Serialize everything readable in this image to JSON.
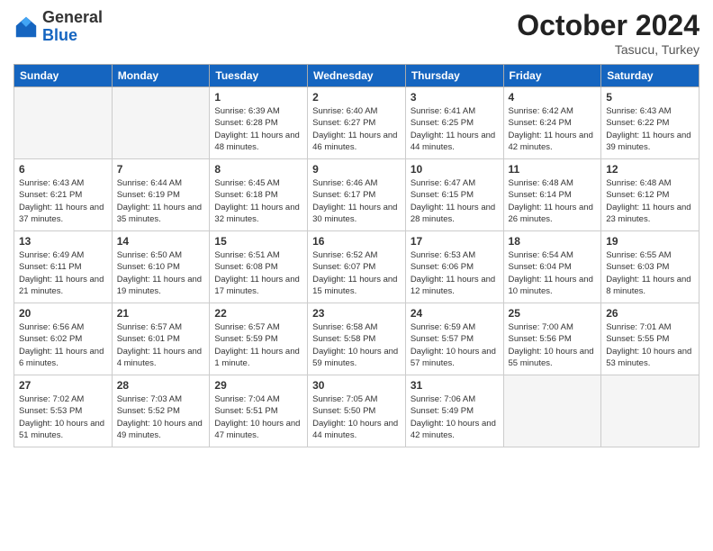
{
  "header": {
    "logo_general": "General",
    "logo_blue": "Blue",
    "month_year": "October 2024",
    "location": "Tasucu, Turkey"
  },
  "weekdays": [
    "Sunday",
    "Monday",
    "Tuesday",
    "Wednesday",
    "Thursday",
    "Friday",
    "Saturday"
  ],
  "weeks": [
    [
      {
        "day": "",
        "info": ""
      },
      {
        "day": "",
        "info": ""
      },
      {
        "day": "1",
        "info": "Sunrise: 6:39 AM\nSunset: 6:28 PM\nDaylight: 11 hours and 48 minutes."
      },
      {
        "day": "2",
        "info": "Sunrise: 6:40 AM\nSunset: 6:27 PM\nDaylight: 11 hours and 46 minutes."
      },
      {
        "day": "3",
        "info": "Sunrise: 6:41 AM\nSunset: 6:25 PM\nDaylight: 11 hours and 44 minutes."
      },
      {
        "day": "4",
        "info": "Sunrise: 6:42 AM\nSunset: 6:24 PM\nDaylight: 11 hours and 42 minutes."
      },
      {
        "day": "5",
        "info": "Sunrise: 6:43 AM\nSunset: 6:22 PM\nDaylight: 11 hours and 39 minutes."
      }
    ],
    [
      {
        "day": "6",
        "info": "Sunrise: 6:43 AM\nSunset: 6:21 PM\nDaylight: 11 hours and 37 minutes."
      },
      {
        "day": "7",
        "info": "Sunrise: 6:44 AM\nSunset: 6:19 PM\nDaylight: 11 hours and 35 minutes."
      },
      {
        "day": "8",
        "info": "Sunrise: 6:45 AM\nSunset: 6:18 PM\nDaylight: 11 hours and 32 minutes."
      },
      {
        "day": "9",
        "info": "Sunrise: 6:46 AM\nSunset: 6:17 PM\nDaylight: 11 hours and 30 minutes."
      },
      {
        "day": "10",
        "info": "Sunrise: 6:47 AM\nSunset: 6:15 PM\nDaylight: 11 hours and 28 minutes."
      },
      {
        "day": "11",
        "info": "Sunrise: 6:48 AM\nSunset: 6:14 PM\nDaylight: 11 hours and 26 minutes."
      },
      {
        "day": "12",
        "info": "Sunrise: 6:48 AM\nSunset: 6:12 PM\nDaylight: 11 hours and 23 minutes."
      }
    ],
    [
      {
        "day": "13",
        "info": "Sunrise: 6:49 AM\nSunset: 6:11 PM\nDaylight: 11 hours and 21 minutes."
      },
      {
        "day": "14",
        "info": "Sunrise: 6:50 AM\nSunset: 6:10 PM\nDaylight: 11 hours and 19 minutes."
      },
      {
        "day": "15",
        "info": "Sunrise: 6:51 AM\nSunset: 6:08 PM\nDaylight: 11 hours and 17 minutes."
      },
      {
        "day": "16",
        "info": "Sunrise: 6:52 AM\nSunset: 6:07 PM\nDaylight: 11 hours and 15 minutes."
      },
      {
        "day": "17",
        "info": "Sunrise: 6:53 AM\nSunset: 6:06 PM\nDaylight: 11 hours and 12 minutes."
      },
      {
        "day": "18",
        "info": "Sunrise: 6:54 AM\nSunset: 6:04 PM\nDaylight: 11 hours and 10 minutes."
      },
      {
        "day": "19",
        "info": "Sunrise: 6:55 AM\nSunset: 6:03 PM\nDaylight: 11 hours and 8 minutes."
      }
    ],
    [
      {
        "day": "20",
        "info": "Sunrise: 6:56 AM\nSunset: 6:02 PM\nDaylight: 11 hours and 6 minutes."
      },
      {
        "day": "21",
        "info": "Sunrise: 6:57 AM\nSunset: 6:01 PM\nDaylight: 11 hours and 4 minutes."
      },
      {
        "day": "22",
        "info": "Sunrise: 6:57 AM\nSunset: 5:59 PM\nDaylight: 11 hours and 1 minute."
      },
      {
        "day": "23",
        "info": "Sunrise: 6:58 AM\nSunset: 5:58 PM\nDaylight: 10 hours and 59 minutes."
      },
      {
        "day": "24",
        "info": "Sunrise: 6:59 AM\nSunset: 5:57 PM\nDaylight: 10 hours and 57 minutes."
      },
      {
        "day": "25",
        "info": "Sunrise: 7:00 AM\nSunset: 5:56 PM\nDaylight: 10 hours and 55 minutes."
      },
      {
        "day": "26",
        "info": "Sunrise: 7:01 AM\nSunset: 5:55 PM\nDaylight: 10 hours and 53 minutes."
      }
    ],
    [
      {
        "day": "27",
        "info": "Sunrise: 7:02 AM\nSunset: 5:53 PM\nDaylight: 10 hours and 51 minutes."
      },
      {
        "day": "28",
        "info": "Sunrise: 7:03 AM\nSunset: 5:52 PM\nDaylight: 10 hours and 49 minutes."
      },
      {
        "day": "29",
        "info": "Sunrise: 7:04 AM\nSunset: 5:51 PM\nDaylight: 10 hours and 47 minutes."
      },
      {
        "day": "30",
        "info": "Sunrise: 7:05 AM\nSunset: 5:50 PM\nDaylight: 10 hours and 44 minutes."
      },
      {
        "day": "31",
        "info": "Sunrise: 7:06 AM\nSunset: 5:49 PM\nDaylight: 10 hours and 42 minutes."
      },
      {
        "day": "",
        "info": ""
      },
      {
        "day": "",
        "info": ""
      }
    ]
  ]
}
